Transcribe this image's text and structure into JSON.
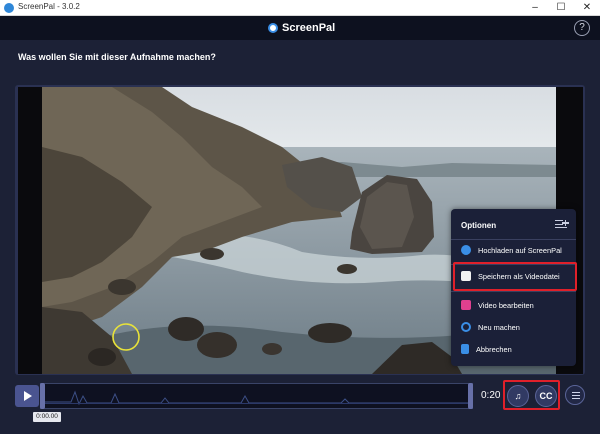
{
  "window": {
    "title": "ScreenPal - 3.0.2",
    "minimize": "–",
    "maximize": "☐",
    "close": "✕"
  },
  "header": {
    "logo_text": "ScreenPal",
    "help_label": "?"
  },
  "question": "Was wollen Sie mit dieser Aufnahme machen?",
  "menu": {
    "title": "Optionen",
    "items": [
      {
        "label": "Hochladen auf ScreenPal",
        "icon": "upload-cloud-icon",
        "color": "#3a8ee6"
      },
      {
        "label": "Speichern als Videodatei",
        "icon": "folder-icon",
        "color": "#f2f2f2",
        "highlighted": true
      },
      {
        "label": "Video bearbeiten",
        "icon": "edit-video-icon",
        "color": "#e0408f"
      },
      {
        "label": "Neu machen",
        "icon": "redo-icon",
        "color": "#3a8ee6"
      },
      {
        "label": "Abbrechen",
        "icon": "trash-icon",
        "color": "#3a8ee6"
      }
    ]
  },
  "player": {
    "current_time": "0:00.00",
    "duration": "0:20",
    "music_icon": "music-note-icon",
    "cc_label": "CC",
    "list_icon": "menu-list-icon"
  },
  "colors": {
    "accent": "#3a8ee6",
    "highlight": "#e0202a",
    "background": "#1c2136"
  }
}
